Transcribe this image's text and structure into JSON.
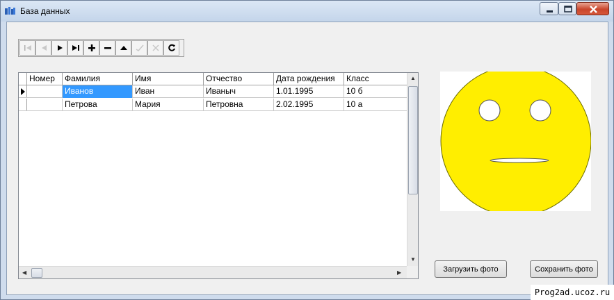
{
  "window": {
    "title": "База данных"
  },
  "toolbar": {
    "buttons": [
      {
        "icon": "first-record-icon",
        "enabled": false
      },
      {
        "icon": "prior-record-icon",
        "enabled": false
      },
      {
        "icon": "next-record-icon",
        "enabled": true
      },
      {
        "icon": "last-record-icon",
        "enabled": true
      },
      {
        "icon": "insert-record-icon",
        "enabled": true
      },
      {
        "icon": "delete-record-icon",
        "enabled": true
      },
      {
        "icon": "edit-record-icon",
        "enabled": true
      },
      {
        "icon": "post-edit-icon",
        "enabled": false
      },
      {
        "icon": "cancel-edit-icon",
        "enabled": false
      },
      {
        "icon": "refresh-data-icon",
        "enabled": true
      }
    ]
  },
  "grid": {
    "columns": [
      "Номер",
      "Фамилия",
      "Имя",
      "Отчество",
      "Дата рождения",
      "Класс"
    ],
    "rows": [
      [
        "",
        "Иванов",
        "Иван",
        "Иваныч",
        "1.01.1995",
        "10 б"
      ],
      [
        "",
        "Петрова",
        "Мария",
        "Петровна",
        "2.02.1995",
        "10 а"
      ]
    ]
  },
  "buttons": {
    "load_photo": "Загрузить фото",
    "save_photo": "Сохранить фото"
  },
  "watermark": "Prog2ad.ucoz.ru",
  "colors": {
    "smiley_fill": "#ffee00",
    "selection": "#3399ff",
    "titlebar": "#cfdced"
  }
}
